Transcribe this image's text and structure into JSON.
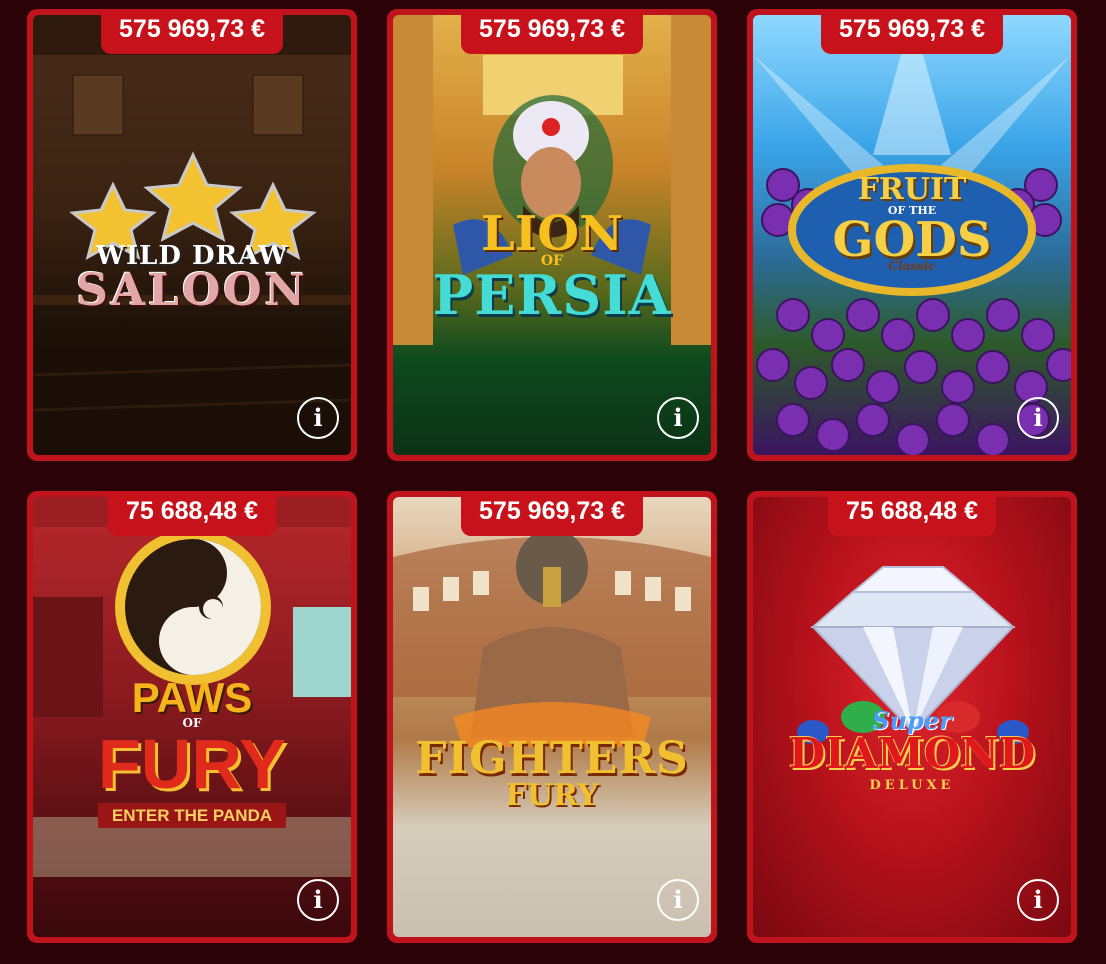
{
  "games": [
    {
      "jackpot": "575 969,73 €",
      "logo": {
        "line1": "WILD DRAW",
        "line2": "SALOON"
      },
      "colors": {
        "bg_top": "#4a2d1a",
        "bg_bottom": "#120804",
        "accent": "#f2c230"
      },
      "info_icon": "info-icon"
    },
    {
      "jackpot": "575 969,73 €",
      "logo": {
        "line1": "LION",
        "line2": "OF",
        "line3": "PERSIA"
      },
      "colors": {
        "bg_top": "#d9a02a",
        "bg_bottom": "#0d3d18",
        "accent": "#3fd6d6"
      },
      "info_icon": "info-icon"
    },
    {
      "jackpot": "575 969,73 €",
      "logo": {
        "line1": "FRUIT",
        "line2": "OF THE",
        "line3": "GODS",
        "line4": "Classic"
      },
      "colors": {
        "bg_top": "#3aa4e8",
        "bg_bottom": "#3b1460",
        "accent": "#7a2fb0"
      },
      "info_icon": "info-icon"
    },
    {
      "jackpot": "75 688,48 €",
      "logo": {
        "line1": "PAWS",
        "line2": "OF",
        "line3": "FURY",
        "line4": "ENTER THE PANDA"
      },
      "colors": {
        "bg_top": "#b0262a",
        "bg_bottom": "#4a0c10",
        "accent": "#f5b31c"
      },
      "info_icon": "info-icon"
    },
    {
      "jackpot": "575 969,73 €",
      "logo": {
        "line1": "FIGHTERS",
        "line2": "FURY"
      },
      "colors": {
        "bg_top": "#e9d7bf",
        "bg_bottom": "#c9bfae",
        "accent": "#e8a21c"
      },
      "info_icon": "info-icon"
    },
    {
      "jackpot": "75 688,48 €",
      "logo": {
        "line1": "Super",
        "line2": "DIAMOND",
        "line3": "DELUXE"
      },
      "colors": {
        "bg_top": "#d01a22",
        "bg_bottom": "#7a0810",
        "accent": "#f3f6ff"
      },
      "info_icon": "info-icon"
    }
  ]
}
